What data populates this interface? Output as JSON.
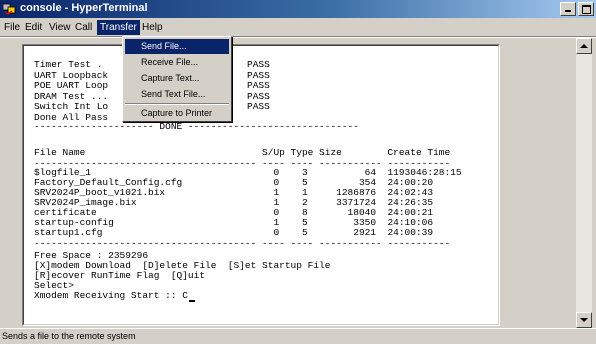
{
  "window": {
    "title": "console - HyperTerminal"
  },
  "menubar": {
    "items": [
      "File",
      "Edit",
      "View",
      "Call",
      "Transfer",
      "Help"
    ],
    "open_item": "Transfer"
  },
  "transfer_menu": {
    "items": [
      "Send File...",
      "Receive File...",
      "Capture Text...",
      "Send Text File...",
      "Capture to Printer"
    ],
    "selected": "Send File..."
  },
  "terminal": {
    "lines": [
      "Timer Test .",
      "UART Loopback",
      "POE UART Loop",
      "DRAM Test ...",
      "Switch Int Lo",
      "Done All Pass",
      "--------------------- DONE ------------------------------",
      "File Name                               S/Up Type Size        Create Time",
      "--------------------------------------- ---- ---- ----------- -----------",
      "$logfile_1                                0    3          64  1193046:28:15",
      "Factory_Default_Config.cfg                0    5         354  24:00:20",
      "SRV2024P_boot_v1021.bix                   1    1     1286876  24:02:43",
      "SRV2024P_image.bix                        1    2     3371724  24:26:35",
      "certificate                               0    8       18040  24:00:21",
      "startup-config                            1    5        3350  24:10:06",
      "startup1.cfg                              0    5        2921  24:00:39",
      "--------------------------------------- ---- ---- ----------- -----------",
      "Free Space : 2359296",
      "[X]modem Download  [D]elete File  [S]et Startup File",
      "[R]ecover RunTime Flag  [Q]uit",
      "Select>",
      "Xmodem Receiving Start :: C"
    ],
    "pass_results": [
      "PASS",
      "PASS",
      "PASS",
      "PASS",
      "PASS"
    ]
  },
  "statusbar": {
    "text": "Sends a file to the remote system"
  },
  "colors": {
    "titlebar": "#0a246a",
    "menu_highlight": "#0a246a",
    "chrome": "#d4d0c8",
    "terminal_bg": "#ffffff"
  },
  "icons": [
    "hyperterminal-app-icon",
    "minimize-icon",
    "maximize-icon",
    "scroll-up-icon",
    "scroll-down-icon"
  ]
}
